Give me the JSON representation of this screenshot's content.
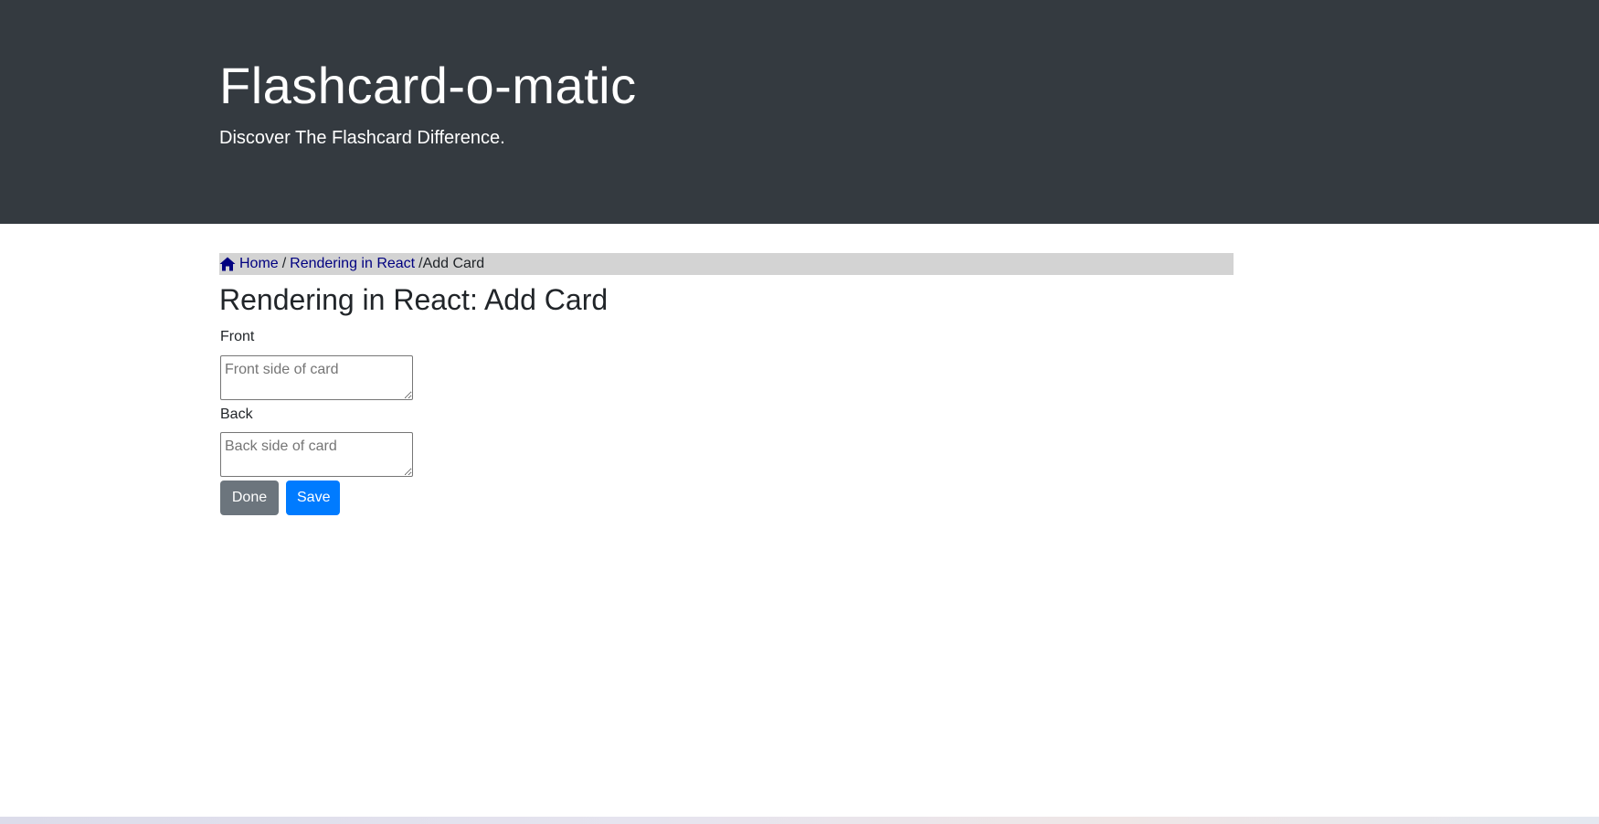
{
  "header": {
    "title": "Flashcard-o-matic",
    "subtitle": "Discover The Flashcard Difference."
  },
  "breadcrumb": {
    "home_icon": "home-icon",
    "home_label": "Home",
    "separator": "/",
    "deck_label": "Rendering in React",
    "current_label": "Add Card"
  },
  "page": {
    "title": "Rendering in React: Add Card"
  },
  "form": {
    "front_label": "Front",
    "front_placeholder": "Front side of card",
    "front_value": "",
    "back_label": "Back",
    "back_placeholder": "Back side of card",
    "back_value": "",
    "done_label": "Done",
    "save_label": "Save"
  },
  "colors": {
    "header_bg": "#343a40",
    "breadcrumb_bg": "#d3d3d3",
    "link": "#000080",
    "done_button": "#6c757d",
    "save_button": "#007bff"
  }
}
